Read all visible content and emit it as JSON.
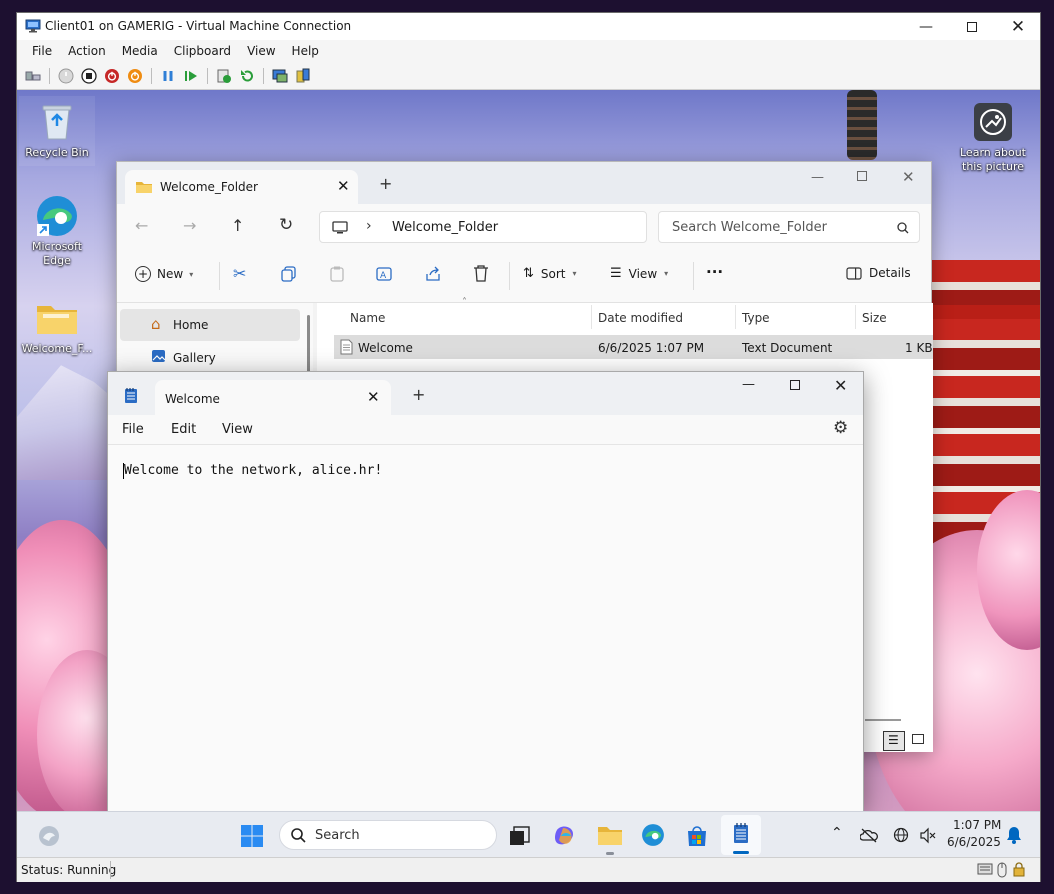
{
  "vm_window": {
    "title": "Client01 on GAMERIG - Virtual Machine Connection",
    "menu": [
      "File",
      "Action",
      "Media",
      "Clipboard",
      "View",
      "Help"
    ],
    "status": "Status: Running"
  },
  "desktop": {
    "icons": [
      {
        "label": "Recycle Bin",
        "icon": "recycle-bin-icon"
      },
      {
        "label": "Microsoft Edge",
        "icon": "edge-icon"
      },
      {
        "label": "Welcome_F...",
        "icon": "folder-icon"
      }
    ],
    "spotlight_label": "Learn about this picture"
  },
  "explorer": {
    "tab_title": "Welcome_Folder",
    "new_tab_label": "+",
    "breadcrumb": "Welcome_Folder",
    "search_placeholder": "Search Welcome_Folder",
    "commands": {
      "new": "New",
      "sort": "Sort",
      "view": "View",
      "more": "···",
      "details": "Details"
    },
    "nav": [
      "Home",
      "Gallery"
    ],
    "columns": [
      "Name",
      "Date modified",
      "Type",
      "Size"
    ],
    "rows": [
      {
        "name": "Welcome",
        "date": "6/6/2025 1:07 PM",
        "type": "Text Document",
        "size": "1 KB"
      }
    ]
  },
  "notepad": {
    "tab_title": "Welcome",
    "new_tab_label": "+",
    "menu": [
      "File",
      "Edit",
      "View"
    ],
    "content": "Welcome to the network, alice.hr!"
  },
  "taskbar": {
    "search_label": "Search",
    "time": "1:07 PM",
    "date": "6/6/2025"
  },
  "colors": {
    "accent": "#0067c0",
    "folder": "#f4c542",
    "selected_row": "#cce8ff"
  }
}
